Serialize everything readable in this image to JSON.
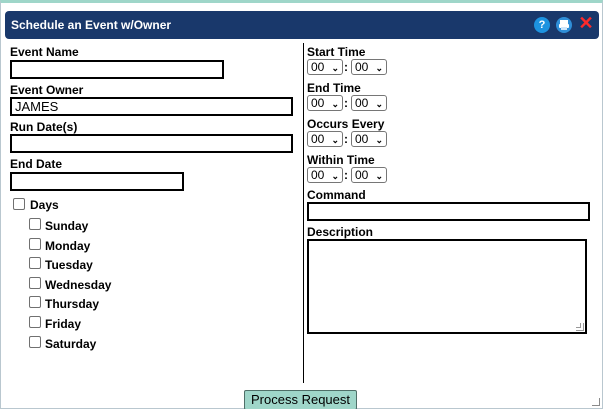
{
  "dialog": {
    "title": "Schedule an Event w/Owner",
    "help_icon": "?",
    "close_icon": "✕"
  },
  "left": {
    "event_name_label": "Event Name",
    "event_name_value": "",
    "event_owner_label": "Event Owner",
    "event_owner_value": "JAMES",
    "run_dates_label": "Run Date(s)",
    "run_dates_value": "",
    "end_date_label": "End Date",
    "end_date_value": "",
    "days_label": "Days",
    "days": [
      "Sunday",
      "Monday",
      "Tuesday",
      "Wednesday",
      "Thursday",
      "Friday",
      "Saturday"
    ]
  },
  "right": {
    "start_time_label": "Start Time",
    "end_time_label": "End Time",
    "occurs_every_label": "Occurs Every",
    "within_time_label": "Within Time",
    "hour_value": "00",
    "minute_value": "00",
    "separator": ":",
    "command_label": "Command",
    "command_value": "",
    "description_label": "Description",
    "description_value": ""
  },
  "footer": {
    "process_button": "Process Request"
  },
  "colors": {
    "titlebar": "#19386b",
    "button": "#9fd6c9",
    "close": "#ff2a2a",
    "help": "#1d93e0"
  }
}
